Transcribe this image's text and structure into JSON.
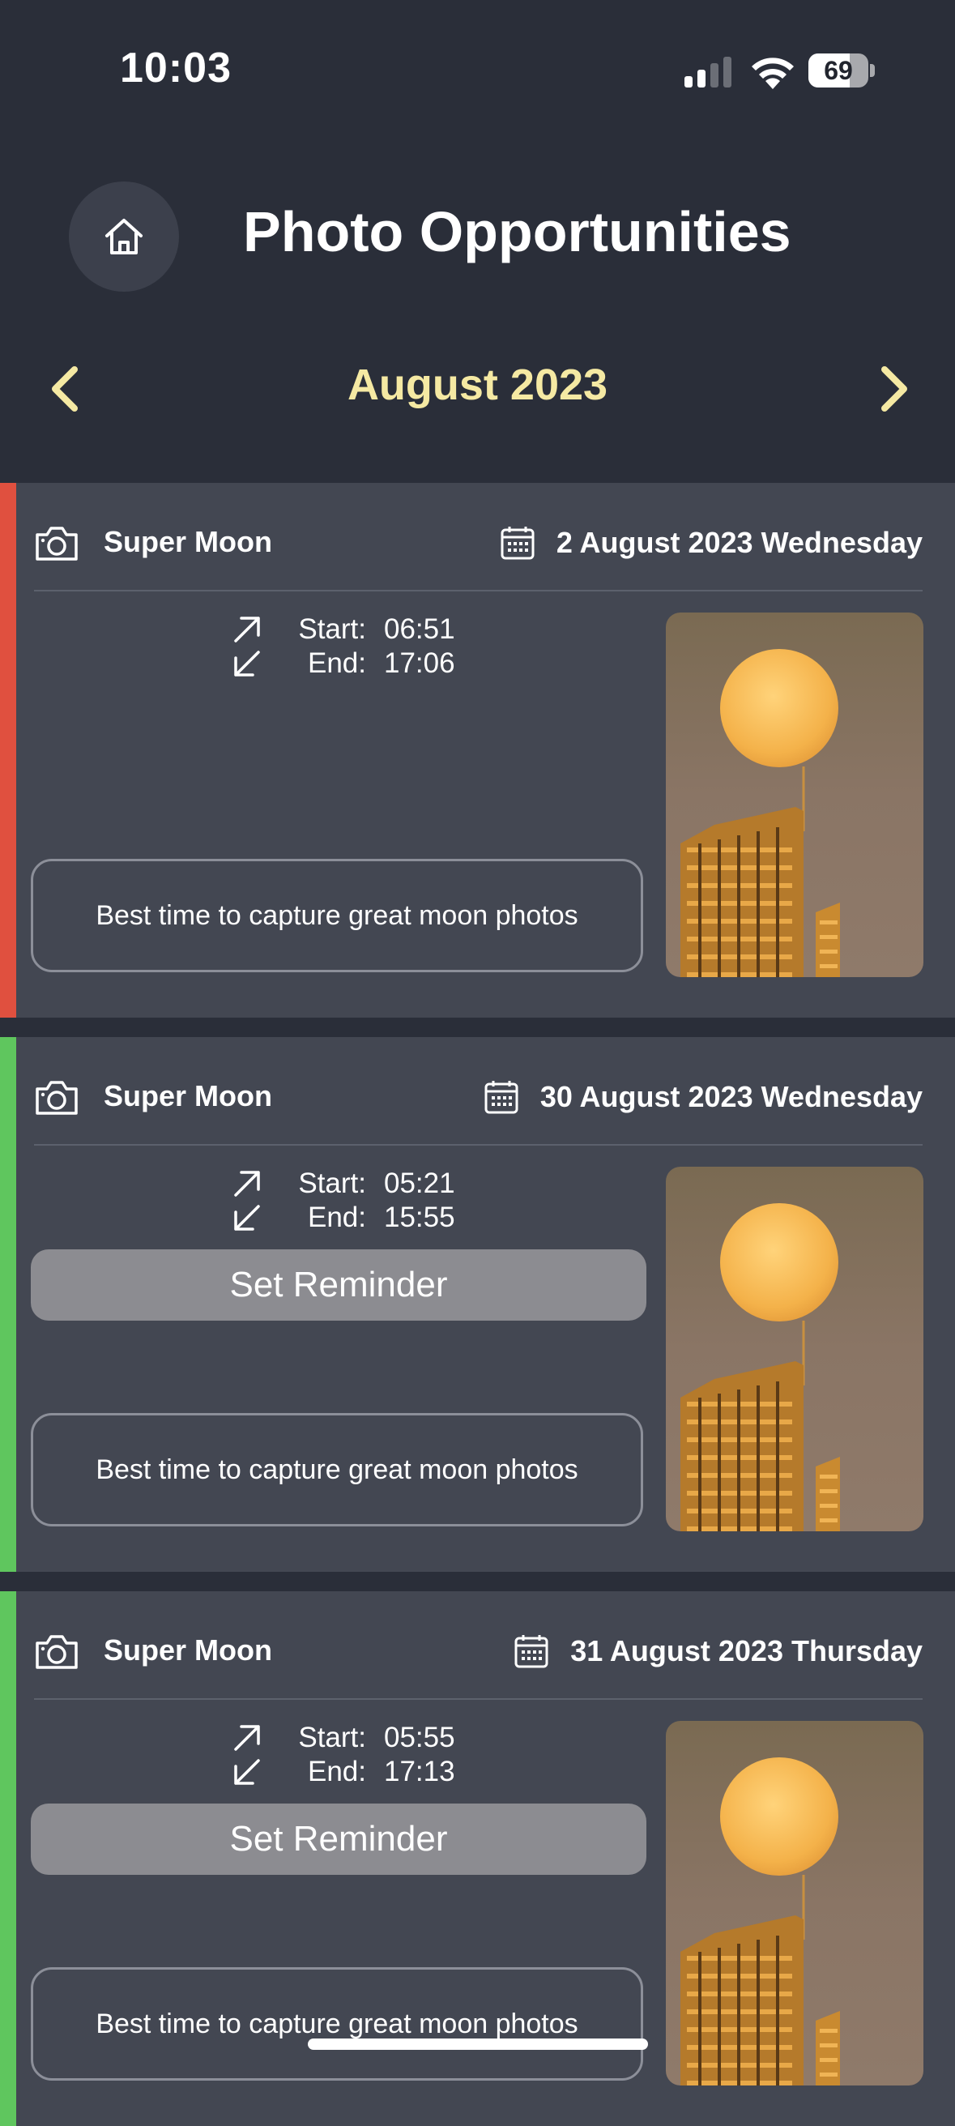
{
  "status_bar": {
    "time": "10:03",
    "battery_level": "69",
    "battery_fraction": 0.69
  },
  "header": {
    "title": "Photo Opportunities",
    "home_icon": "home-icon"
  },
  "month_nav": {
    "label": "August 2023",
    "prev_icon": "chevron-left-icon",
    "next_icon": "chevron-right-icon"
  },
  "colors": {
    "background": "#2a2e39",
    "card": "#434752",
    "accent_past": "#e0503f",
    "accent_upcoming": "#5fc65e",
    "month_label": "#f5e9a3",
    "button": "#8c8c91"
  },
  "events": [
    {
      "title": "Super Moon",
      "date": "2 August 2023 Wednesday",
      "start_label": "Start:",
      "start": "06:51",
      "end_label": "End:",
      "end": "17:06",
      "reminder_label": "",
      "description": "Best time to capture great moon photos",
      "status_color": "#e0503f"
    },
    {
      "title": "Super Moon",
      "date": "30 August 2023 Wednesday",
      "start_label": "Start:",
      "start": "05:21",
      "end_label": "End:",
      "end": "15:55",
      "reminder_label": "Set Reminder",
      "description": "Best time to capture great moon photos",
      "status_color": "#5fc65e"
    },
    {
      "title": "Super Moon",
      "date": "31 August 2023 Thursday",
      "start_label": "Start:",
      "start": "05:55",
      "end_label": "End:",
      "end": "17:13",
      "reminder_label": "Set Reminder",
      "description": "Best time to capture great moon photos",
      "status_color": "#5fc65e"
    }
  ]
}
